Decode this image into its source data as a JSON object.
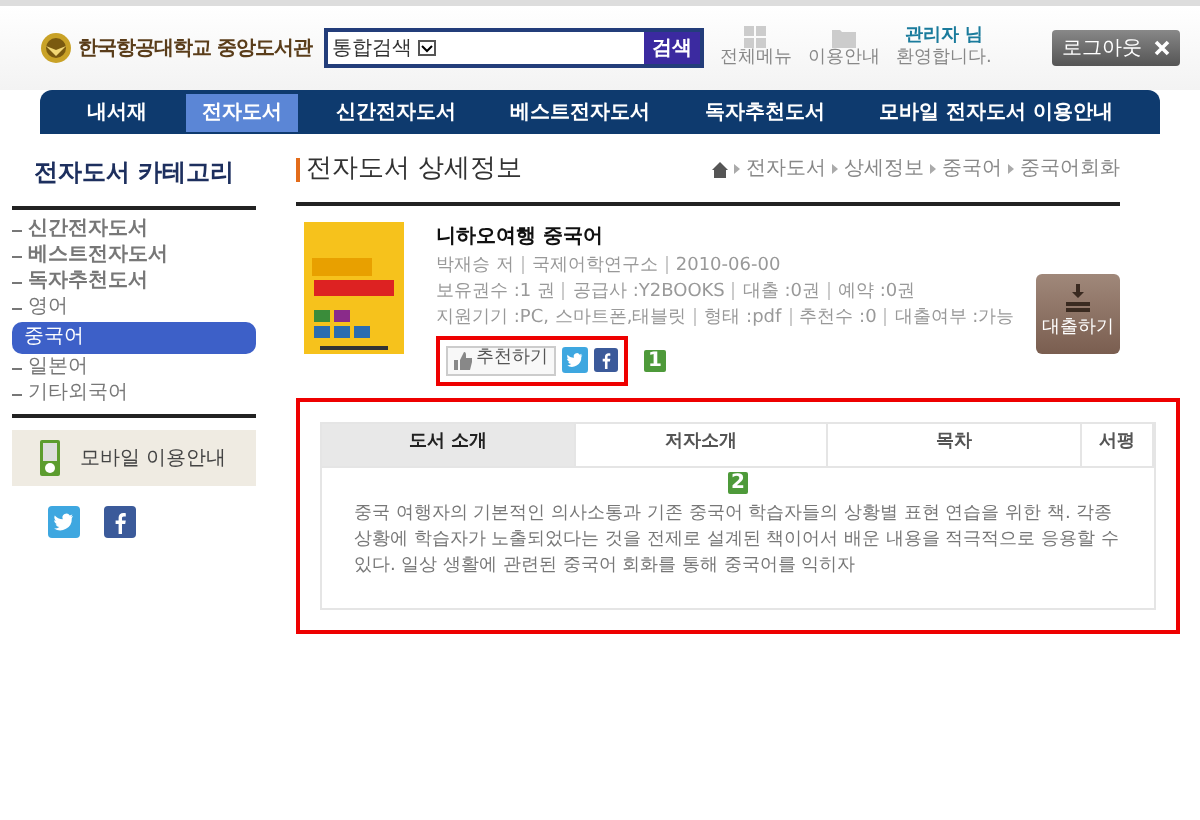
{
  "header": {
    "logo": "한국항공대학교 중앙도서관",
    "search": {
      "scope": "통합검색",
      "button": "검색"
    },
    "links": [
      {
        "label": "전체메뉴"
      },
      {
        "label": "이용안내"
      }
    ],
    "user": {
      "name": "관리자 님",
      "greeting": "환영합니다."
    },
    "logout": "로그아웃"
  },
  "nav": [
    {
      "label": "내서재",
      "selected": false
    },
    {
      "label": "전자도서",
      "selected": true
    },
    {
      "label": "신간전자도서",
      "selected": false
    },
    {
      "label": "베스트전자도서",
      "selected": false
    },
    {
      "label": "독자추천도서",
      "selected": false
    },
    {
      "label": "모바일 전자도서 이용안내",
      "selected": false
    }
  ],
  "sidebar": {
    "title": "전자도서 카테고리",
    "categories": [
      {
        "label": "신간전자도서",
        "bold": true,
        "selected": false
      },
      {
        "label": "베스트전자도서",
        "bold": true,
        "selected": false
      },
      {
        "label": "독자추천도서",
        "bold": true,
        "selected": false
      },
      {
        "label": "영어",
        "bold": false,
        "selected": false
      },
      {
        "label": "중국어",
        "bold": false,
        "selected": true
      },
      {
        "label": "일본어",
        "bold": false,
        "selected": false
      },
      {
        "label": "기타외국어",
        "bold": false,
        "selected": false
      }
    ],
    "mobile_banner": "모바일 이용안내"
  },
  "main": {
    "title": "전자도서 상세정보",
    "breadcrumb": [
      "전자도서",
      "상세정보",
      "중국어",
      "중국어회화"
    ],
    "book": {
      "title": "니하오여행 중국어",
      "meta": [
        [
          "박재승 저",
          "국제어학연구소",
          "2010-06-00"
        ],
        [
          "보유권수 :1 권",
          "공급사 :Y2BOOKS",
          "대출 :0권",
          "예약 :0권"
        ],
        [
          "지원기기 :PC, 스마트폰,태블릿",
          "형태 :pdf",
          "추천수 :0",
          "대출여부 :가능"
        ]
      ],
      "recommend": "추천하기",
      "loan": "대출하기"
    },
    "annotations": [
      "1",
      "2"
    ],
    "tabs": [
      {
        "label": "도서 소개",
        "selected": true
      },
      {
        "label": "저자소개",
        "selected": false
      },
      {
        "label": "목차",
        "selected": false
      },
      {
        "label": "서평",
        "selected": false
      }
    ],
    "description": "중국 여행자의 기본적인 의사소통과 기존 중국어 학습자들의 상황별 표현 연습을 위한 책. 각종 상황에 학습자가 노출되었다는 것을 전제로 설계된 책이어서 배운 내용을 적극적으로 응용할 수 있다. 일상 생활에 관련된 중국어 회화를 통해 중국어를 익히자"
  }
}
